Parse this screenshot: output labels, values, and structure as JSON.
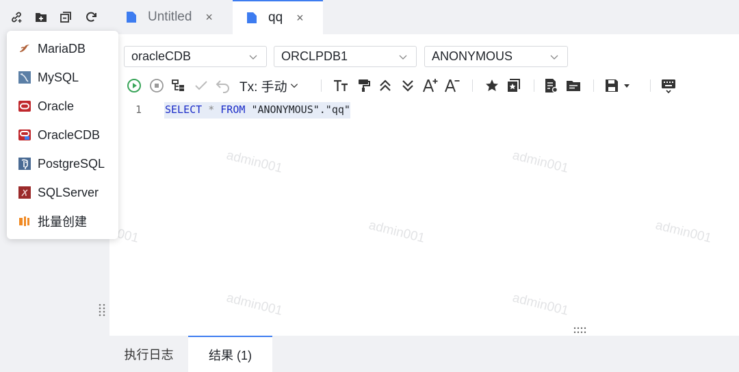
{
  "tabs": [
    {
      "label": "Untitled",
      "close": "×"
    },
    {
      "label": "qq",
      "close": "×"
    }
  ],
  "add_menu": {
    "items": [
      {
        "label": "MariaDB",
        "icon": "mariadb-icon"
      },
      {
        "label": "MySQL",
        "icon": "mysql-icon"
      },
      {
        "label": "Oracle",
        "icon": "oracle-icon"
      },
      {
        "label": "OracleCDB",
        "icon": "oraclecdb-icon"
      },
      {
        "label": "PostgreSQL",
        "icon": "postgresql-icon"
      },
      {
        "label": "SQLServer",
        "icon": "sqlserver-icon"
      },
      {
        "label": "批量创建",
        "icon": "batch-create-icon"
      }
    ]
  },
  "selectors": {
    "datasource": "oracleCDB",
    "database": "ORCLPDB1",
    "schema": "ANONYMOUS"
  },
  "toolbar": {
    "tx_mode": "Tx: 手动"
  },
  "editor": {
    "line_number": "1",
    "code": {
      "kw_select": "SELECT",
      "star": "*",
      "kw_from": "FROM",
      "table": "\"ANONYMOUS\".\"qq\""
    },
    "watermark_text": "admin001"
  },
  "bottom_tabs": {
    "log": "执行日志",
    "result": "结果 (1)"
  },
  "colors": {
    "accent": "#3d7cf0",
    "keyword": "#1a2bc8",
    "run_green": "#3aa55a"
  }
}
